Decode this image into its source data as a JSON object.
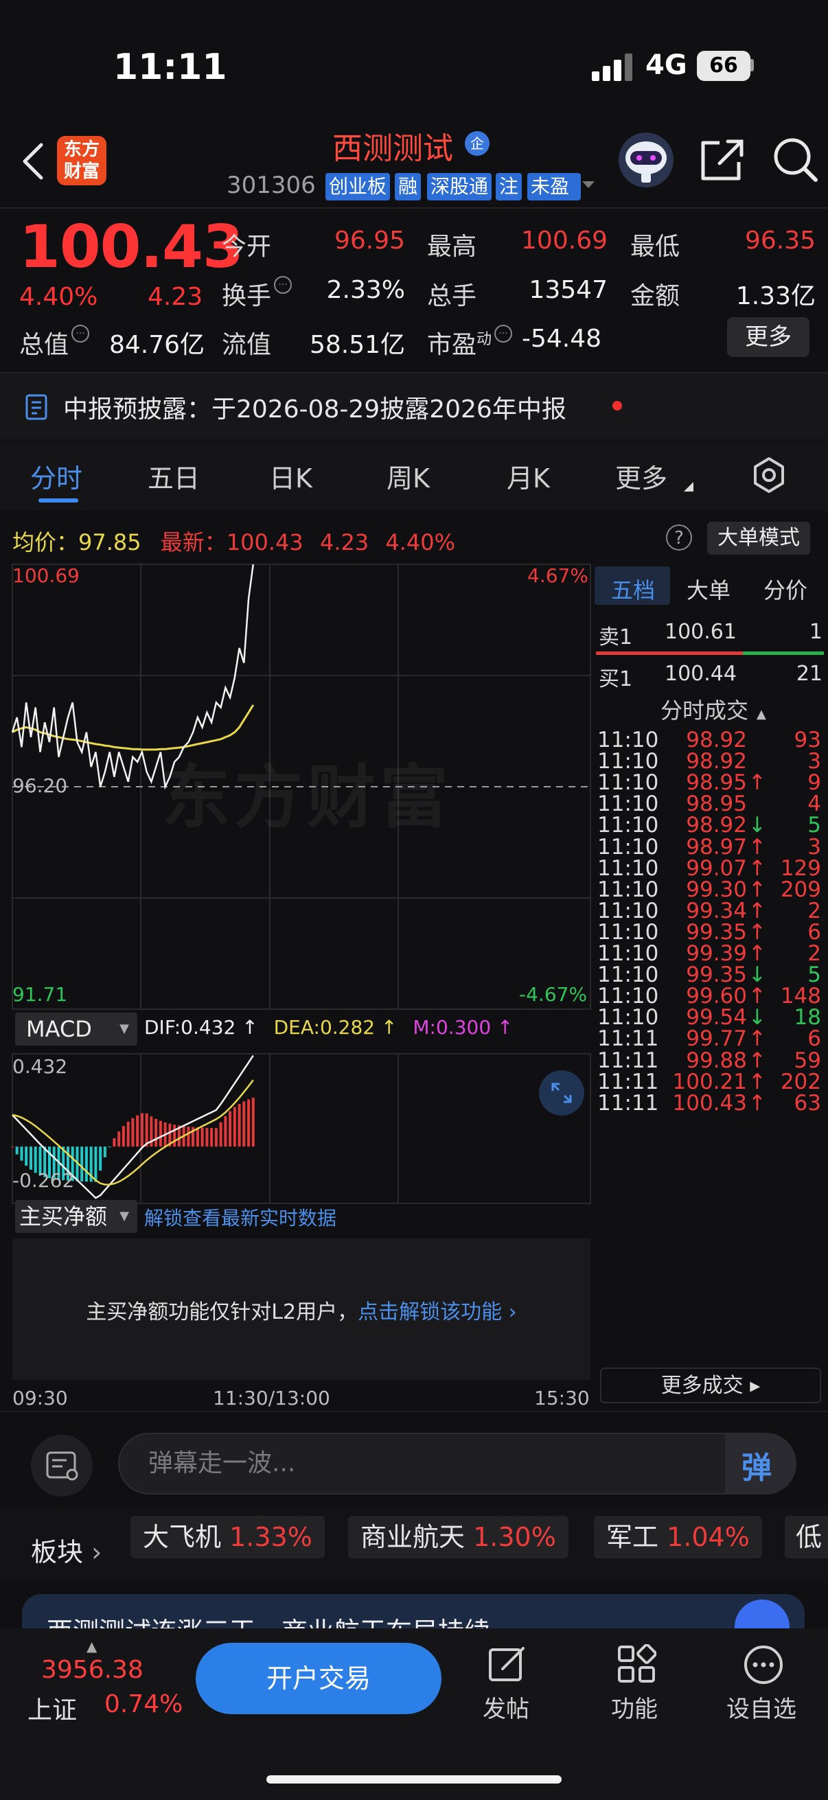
{
  "status": {
    "time": "11:11",
    "network": "4G",
    "battery": "66"
  },
  "header": {
    "logo_text": "东方财富",
    "stock_name": "西测测试",
    "badge": "企",
    "code": "301306",
    "tags": [
      "创业板",
      "融",
      "深股通",
      "注",
      "未盈"
    ]
  },
  "quote": {
    "price": "100.43",
    "change_pct": "4.40%",
    "change_amt": "4.23",
    "open_label": "今开",
    "open": "96.95",
    "high_label": "最高",
    "high": "100.69",
    "low_label": "最低",
    "low": "96.35",
    "turnover_label": "换手",
    "turnover": "2.33%",
    "volume_label": "总手",
    "volume": "13547",
    "amount_label": "金额",
    "amount": "1.33亿",
    "mktcap_label": "总值",
    "mktcap": "84.76亿",
    "float_label": "流值",
    "float": "58.51亿",
    "pe_label": "市盈",
    "pe_sup": "动",
    "pe": "-54.48",
    "more": "更多"
  },
  "notice": {
    "text": "中报预披露：于2026-08-29披露2026年中报"
  },
  "tabs": [
    "分时",
    "五日",
    "日K",
    "周K",
    "月K",
    "更多"
  ],
  "avg_row": {
    "avg_label": "均价：",
    "avg": "97.85",
    "latest_label": "最新：",
    "latest": "100.43",
    "chg": "4.23",
    "pct": "4.40%",
    "help": "?",
    "big_order_btn": "大单模式"
  },
  "chart": {
    "y_high": "100.69",
    "y_high_pct": "4.67%",
    "y_mid": "96.20",
    "y_low": "91.71",
    "y_low_pct": "-4.67%",
    "watermark": "东方财富",
    "macd_label": "MACD",
    "dif": "DIF:0.432 ↑",
    "dea": "DEA:0.282 ↑",
    "m": "M:0.300 ↑",
    "macd_high": "0.432",
    "macd_low": "-0.262",
    "netbuy_label": "主买净额",
    "netbuy_link": "解锁查看最新实时数据",
    "netbuy_msg": "主买净额功能仅针对L2用户，",
    "netbuy_unlock": "点击解锁该功能",
    "time_start": "09:30",
    "time_mid": "11:30/13:00",
    "time_end": "15:30"
  },
  "colors": {
    "up": "#f03b3b",
    "down": "#2ec45a",
    "accent": "#3d8bf0",
    "avg_line": "#e8d84a"
  },
  "chart_data": {
    "type": "line",
    "ylim": [
      91.71,
      100.69
    ],
    "base": 96.2,
    "price_series": [
      97.3,
      97.6,
      97.0,
      97.9,
      97.2,
      97.8,
      96.9,
      97.5,
      97.1,
      97.8,
      96.8,
      97.2,
      97.6,
      97.9,
      97.1,
      96.9,
      97.3,
      96.6,
      96.9,
      96.2,
      96.5,
      96.9,
      96.4,
      96.9,
      96.6,
      96.3,
      96.8,
      96.7,
      96.9,
      96.5,
      96.3,
      96.6,
      96.9,
      96.2,
      96.4,
      96.7,
      96.8,
      97.0,
      97.1,
      97.3,
      97.6,
      97.4,
      97.7,
      97.5,
      97.9,
      97.8,
      98.2,
      98.0,
      98.4,
      99.0,
      98.7,
      100.0,
      100.69
    ],
    "avg_series": [
      97.3,
      97.35,
      97.38,
      97.4,
      97.38,
      97.35,
      97.3,
      97.28,
      97.25,
      97.22,
      97.2,
      97.18,
      97.16,
      97.15,
      97.14,
      97.12,
      97.1,
      97.08,
      97.06,
      97.05,
      97.03,
      97.02,
      97.0,
      96.99,
      96.98,
      96.97,
      96.96,
      96.96,
      96.95,
      96.95,
      96.95,
      96.95,
      96.96,
      96.96,
      96.97,
      96.98,
      96.99,
      97.0,
      97.02,
      97.04,
      97.06,
      97.08,
      97.1,
      97.12,
      97.14,
      97.16,
      97.2,
      97.24,
      97.3,
      97.4,
      97.55,
      97.7,
      97.85
    ]
  },
  "orderbook": {
    "tabs": [
      "五档",
      "大单",
      "分价"
    ],
    "sell": {
      "label": "卖1",
      "price": "100.61",
      "vol": "1"
    },
    "buy": {
      "label": "买1",
      "price": "100.44",
      "vol": "21"
    },
    "trades_title": "分时成交",
    "trades": [
      {
        "t": "11:10",
        "p": "98.92",
        "a": "",
        "v": "93",
        "c": "red"
      },
      {
        "t": "11:10",
        "p": "98.92",
        "a": "",
        "v": "3",
        "c": "red"
      },
      {
        "t": "11:10",
        "p": "98.95",
        "a": "↑",
        "v": "9",
        "c": "red"
      },
      {
        "t": "11:10",
        "p": "98.95",
        "a": "",
        "v": "4",
        "c": "red"
      },
      {
        "t": "11:10",
        "p": "98.92",
        "a": "↓",
        "v": "5",
        "c": "green"
      },
      {
        "t": "11:10",
        "p": "98.97",
        "a": "↑",
        "v": "3",
        "c": "red"
      },
      {
        "t": "11:10",
        "p": "99.07",
        "a": "↑",
        "v": "129",
        "c": "red"
      },
      {
        "t": "11:10",
        "p": "99.30",
        "a": "↑",
        "v": "209",
        "c": "red"
      },
      {
        "t": "11:10",
        "p": "99.34",
        "a": "↑",
        "v": "2",
        "c": "red"
      },
      {
        "t": "11:10",
        "p": "99.35",
        "a": "↑",
        "v": "6",
        "c": "red"
      },
      {
        "t": "11:10",
        "p": "99.39",
        "a": "↑",
        "v": "2",
        "c": "red"
      },
      {
        "t": "11:10",
        "p": "99.35",
        "a": "↓",
        "v": "5",
        "c": "green"
      },
      {
        "t": "11:10",
        "p": "99.60",
        "a": "↑",
        "v": "148",
        "c": "red"
      },
      {
        "t": "11:10",
        "p": "99.54",
        "a": "↓",
        "v": "18",
        "c": "green"
      },
      {
        "t": "11:11",
        "p": "99.77",
        "a": "↑",
        "v": "6",
        "c": "red"
      },
      {
        "t": "11:11",
        "p": "99.88",
        "a": "↑",
        "v": "59",
        "c": "red"
      },
      {
        "t": "11:11",
        "p": "100.21",
        "a": "↑",
        "v": "202",
        "c": "red"
      },
      {
        "t": "11:11",
        "p": "100.43",
        "a": "↑",
        "v": "63",
        "c": "red"
      }
    ],
    "more_trades": "更多成交 ▸"
  },
  "comment": {
    "placeholder": "弹幕走一波...",
    "send": "弹"
  },
  "sectors": {
    "label": "板块",
    "items": [
      {
        "name": "大飞机",
        "pct": "1.33%"
      },
      {
        "name": "商业航天",
        "pct": "1.30%"
      },
      {
        "name": "军工",
        "pct": "1.04%"
      },
      {
        "name": "低",
        "pct": ""
      }
    ]
  },
  "ai_banner": {
    "text": "西测测试连涨三天，商业航天布局持续"
  },
  "bottom": {
    "index_value": "3956.38",
    "index_name": "上证",
    "index_pct": "0.74%",
    "trade_btn": "开户交易",
    "nav": [
      "发帖",
      "功能",
      "设自选"
    ]
  }
}
